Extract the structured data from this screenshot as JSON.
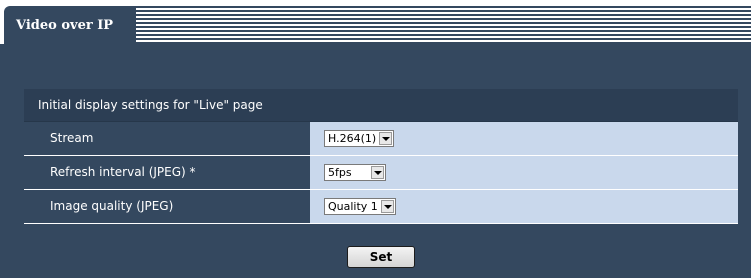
{
  "page": {
    "title": "Video over IP"
  },
  "section": {
    "header": "Initial display settings for \"Live\" page"
  },
  "settings": [
    {
      "label": "Stream",
      "value": "H.264(1)"
    },
    {
      "label": "Refresh interval (JPEG) *",
      "value": "5fps"
    },
    {
      "label": "Image quality (JPEG)",
      "value": "Quality 1"
    }
  ],
  "actions": {
    "set_label": "Set"
  },
  "colors": {
    "panel_bg": "#34485f",
    "value_cell_bg": "#c9d8ec",
    "header_bg": "#2c3e54"
  }
}
